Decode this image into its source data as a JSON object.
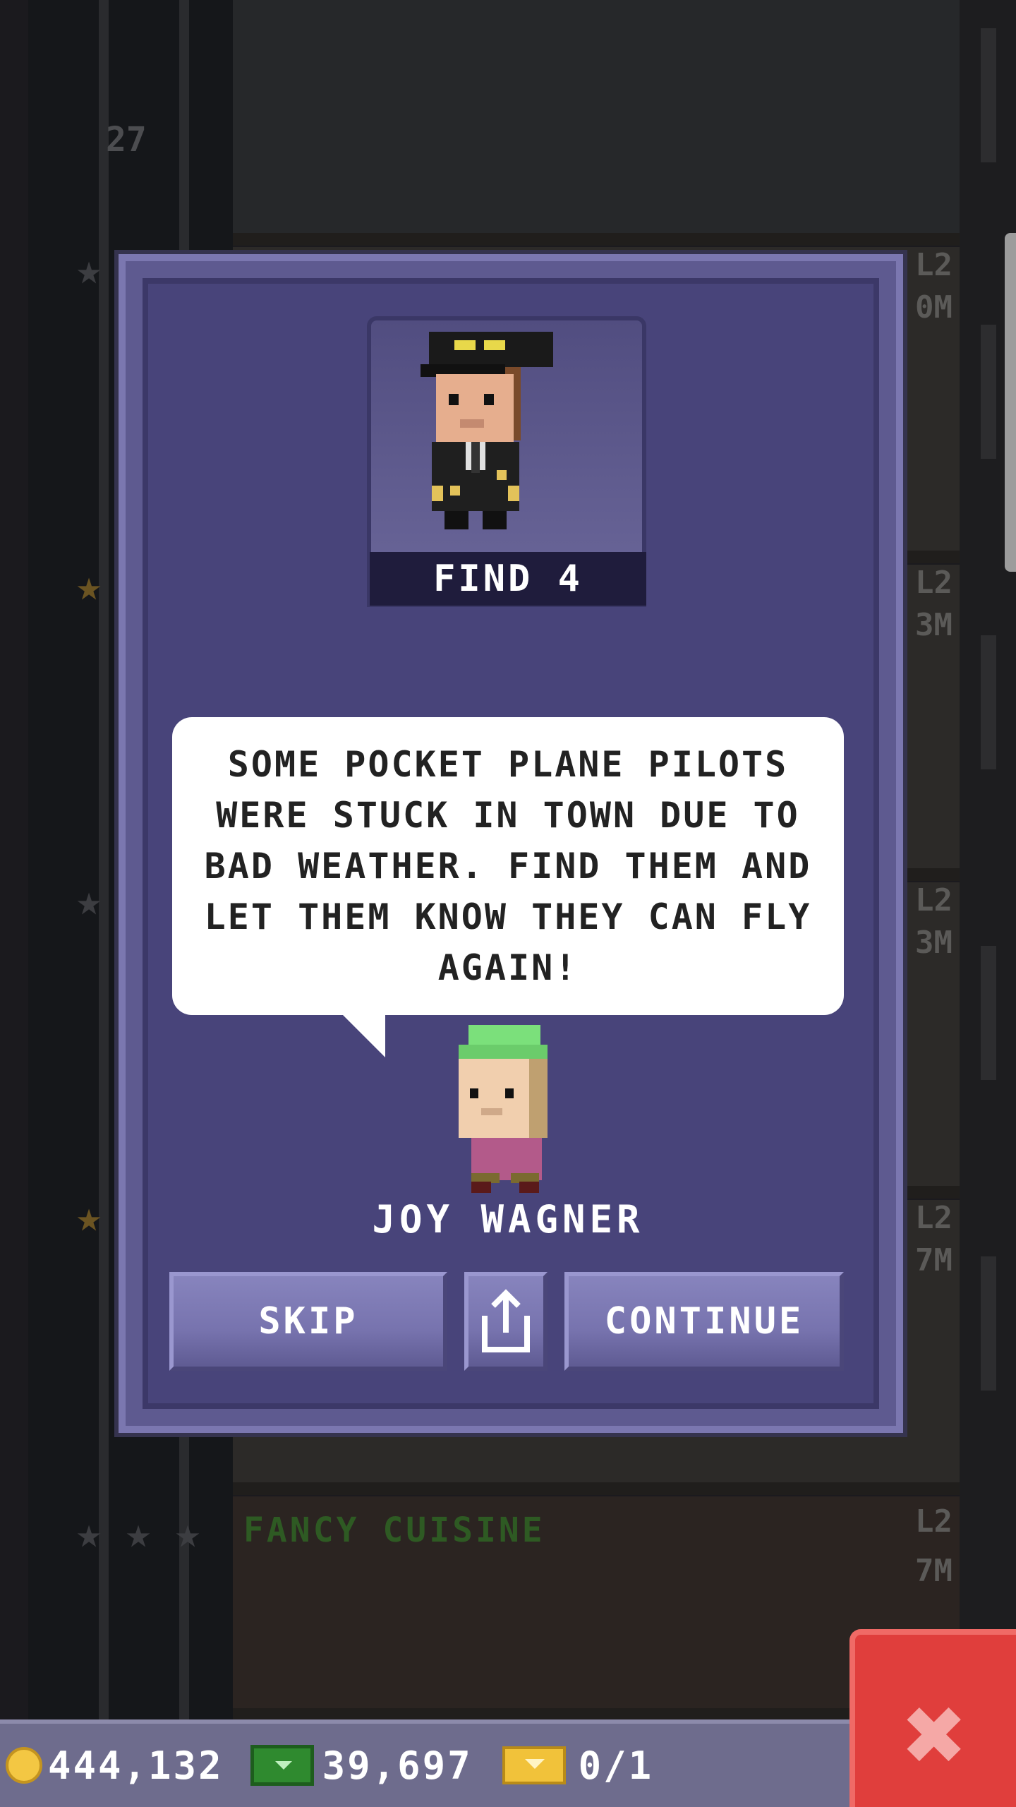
{
  "mission": {
    "find_label": "FIND 4",
    "message": "SOME POCKET PLANE PILOTS WERE STUCK IN TOWN DUE TO BAD WEATHER. FIND THEM AND LET THEM KNOW THEY CAN FLY AGAIN!",
    "npc_name": "JOY WAGNER"
  },
  "buttons": {
    "skip": "SKIP",
    "continue": "CONTINUE"
  },
  "status": {
    "coins": "444,132",
    "bux": "39,697",
    "tickets": "0/1"
  },
  "background": {
    "floor_numbers": [
      "27"
    ],
    "floor_tags": [
      "L2",
      "0M",
      "L2",
      "3M",
      "L2",
      "3M",
      "L2",
      "7M",
      "L2",
      "7M"
    ],
    "restaurant_name": "FANCY CUISINE"
  },
  "icons": {
    "coin": "coin-icon",
    "bux": "bux-icon",
    "ticket": "vip-ticket-icon",
    "share": "share-icon",
    "close": "close-icon"
  },
  "colors": {
    "dialog": "#5e5a90",
    "button": "#7773ae",
    "close": "#e03e3c",
    "coin": "#f3c743",
    "bux": "#2f8a2f"
  }
}
